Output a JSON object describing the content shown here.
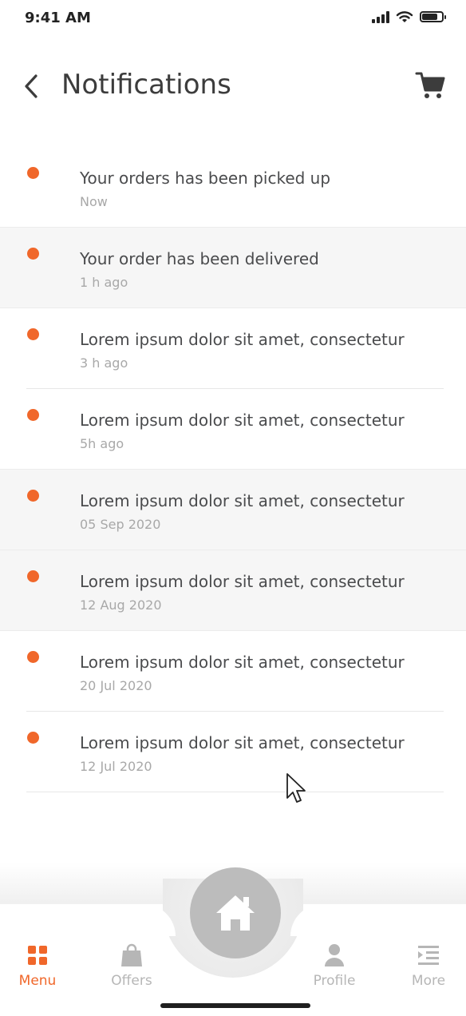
{
  "status_bar": {
    "time": "9:41 AM",
    "battery_level": 0.85
  },
  "header": {
    "title": "Notifications"
  },
  "icons": {
    "back": "chevron-left-icon",
    "cart": "cart-icon",
    "home": "home-icon",
    "menu": "grid-icon",
    "offers": "bag-icon",
    "profile": "person-icon",
    "more": "list-icon"
  },
  "colors": {
    "accent": "#f0672a",
    "inactive": "#b6b6b6",
    "home_button": "#bcbcbc"
  },
  "notifications": [
    {
      "message": "Your orders has been picked up",
      "time": "Now"
    },
    {
      "message": "Your order has been delivered",
      "time": "1 h ago"
    },
    {
      "message": "Lorem ipsum dolor sit amet, consectetur",
      "time": "3 h ago"
    },
    {
      "message": "Lorem ipsum dolor sit amet, consectetur",
      "time": "5h ago"
    },
    {
      "message": "Lorem ipsum dolor sit amet, consectetur",
      "time": "05 Sep 2020"
    },
    {
      "message": "Lorem ipsum dolor sit amet, consectetur",
      "time": "12 Aug 2020"
    },
    {
      "message": "Lorem ipsum dolor sit amet, consectetur",
      "time": "20 Jul 2020"
    },
    {
      "message": "Lorem ipsum dolor sit amet, consectetur",
      "time": "12 Jul 2020"
    }
  ],
  "bottom_nav": {
    "items": [
      {
        "label": "Menu",
        "active": true
      },
      {
        "label": "Offers",
        "active": false
      },
      {
        "label": "Profile",
        "active": false
      },
      {
        "label": "More",
        "active": false
      }
    ]
  }
}
